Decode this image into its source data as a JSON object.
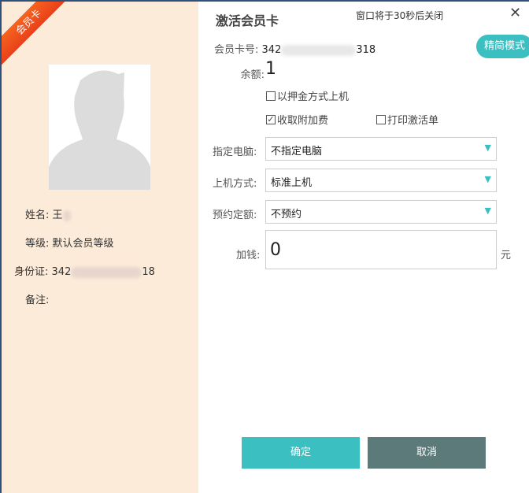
{
  "badge": "会员卡",
  "title": "激活会员卡",
  "timer": "窗口将于30秒后关闭",
  "profile": {
    "name_label": "姓名:",
    "name": "王",
    "level_label": "等级:",
    "level": "默认会员等级",
    "id_label": "身份证:",
    "id_prefix": "342",
    "id_suffix": "18",
    "note_label": "备注:"
  },
  "card": {
    "label": "会员卡号:",
    "prefix": "342",
    "suffix": "318"
  },
  "balance": {
    "label": "余额:",
    "value": "1"
  },
  "mode_button": "精简模式",
  "options": {
    "deposit": {
      "label": "以押金方式上机",
      "checked": false
    },
    "surcharge": {
      "label": "收取附加费",
      "checked": true
    },
    "print": {
      "label": "打印激活单",
      "checked": false
    }
  },
  "fields": {
    "pc_label": "指定电脑:",
    "pc": "不指定电脑",
    "method_label": "上机方式:",
    "method": "标准上机",
    "reserve_label": "预约定额:",
    "reserve": "不预约",
    "add_label": "加钱:",
    "add": "0",
    "unit": "元"
  },
  "buttons": {
    "ok": "确定",
    "cancel": "取消"
  },
  "colors": {
    "accent": "#3bbfc1",
    "cancel": "#5d7a7a"
  }
}
